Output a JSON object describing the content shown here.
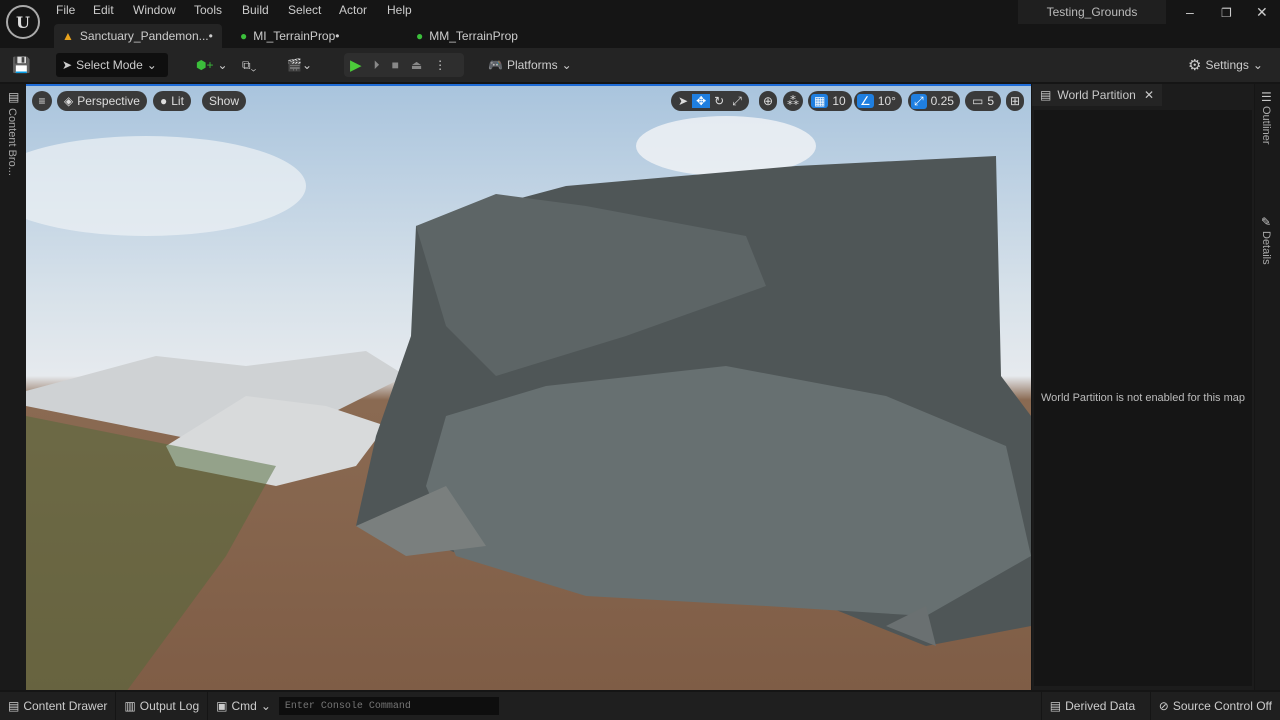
{
  "menu": [
    "File",
    "Edit",
    "Window",
    "Tools",
    "Build",
    "Select",
    "Actor",
    "Help"
  ],
  "tabs": [
    {
      "label": "Sanctuary_Pandemon...•"
    },
    {
      "label": "MI_TerrainProp•"
    },
    {
      "label": "MM_TerrainProp"
    }
  ],
  "project": "Testing_Grounds",
  "toolbar": {
    "select_mode": "Select Mode",
    "platforms": "Platforms",
    "settings": "Settings"
  },
  "viewport": {
    "perspective": "Perspective",
    "lit": "Lit",
    "show": "Show",
    "grid_snap": "10",
    "rot_snap": "10°",
    "scale_snap": "0.25",
    "camera_speed": "5"
  },
  "left_strip": {
    "content_browser": "Content Bro..."
  },
  "right_panel": {
    "title": "World Partition",
    "message": "World Partition is not enabled for this map"
  },
  "right_strip": {
    "outliner": "Outliner",
    "details": "Details"
  },
  "bottom": {
    "content_drawer": "Content Drawer",
    "output_log": "Output Log",
    "cmd": "Cmd",
    "console_placeholder": "Enter Console Command",
    "derived_data": "Derived Data",
    "source_control": "Source Control Off"
  }
}
